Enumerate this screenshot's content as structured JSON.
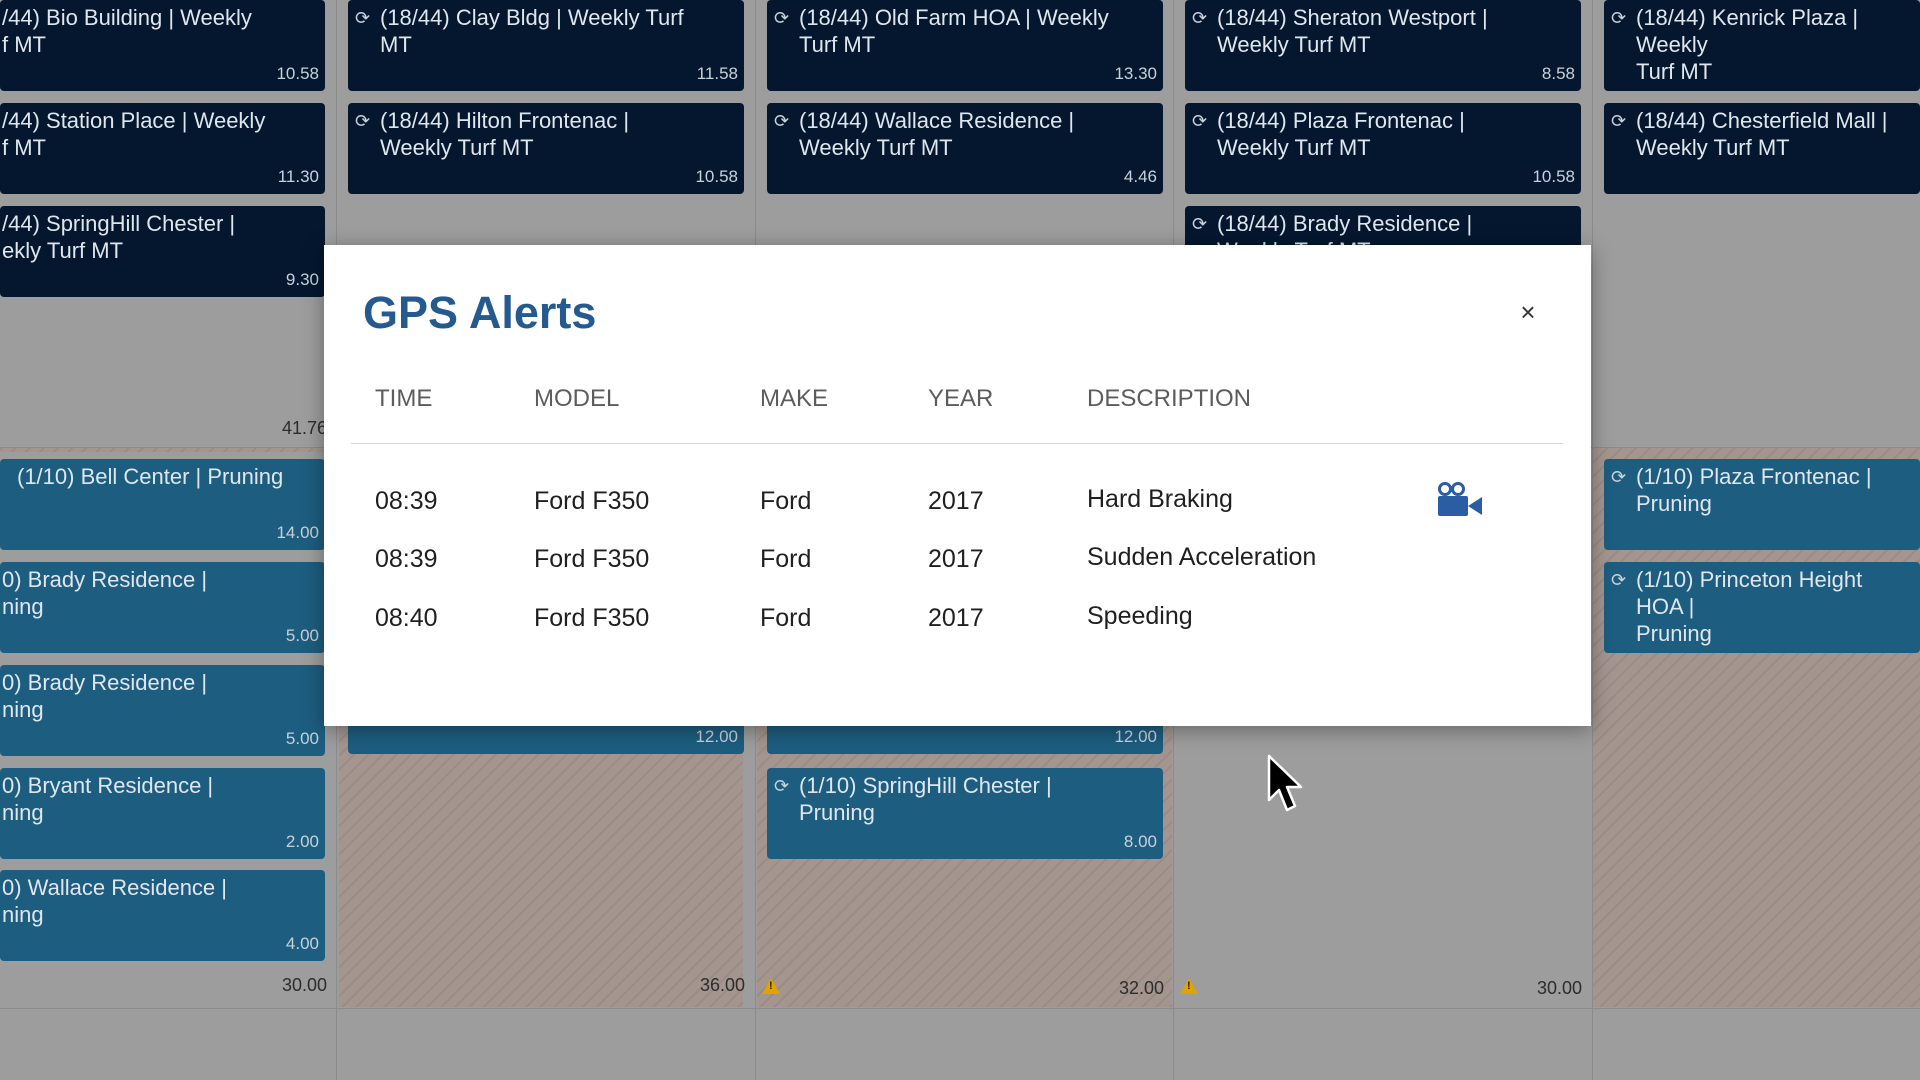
{
  "scheduler": {
    "top_cards": [
      {
        "title": "/44) Bio Building | Weekly\nf MT",
        "hours": "10.58"
      },
      {
        "title": "(18/44) Clay Bldg | Weekly Turf\nMT",
        "hours": "11.58"
      },
      {
        "title": "(18/44) Old Farm HOA | Weekly\nTurf MT",
        "hours": "13.30"
      },
      {
        "title": "(18/44) Sheraton Westport |\nWeekly Turf MT",
        "hours": "8.58"
      },
      {
        "title": "(18/44) Kenrick Plaza | Weekly\nTurf MT",
        "hours": ""
      },
      {
        "title": "/44) Station Place | Weekly\nf MT",
        "hours": "11.30"
      },
      {
        "title": "(18/44) Hilton Frontenac |\nWeekly Turf MT",
        "hours": "10.58"
      },
      {
        "title": "(18/44) Wallace Residence |\nWeekly Turf MT",
        "hours": "4.46"
      },
      {
        "title": "(18/44) Plaza Frontenac |\nWeekly Turf MT",
        "hours": "10.58"
      },
      {
        "title": "(18/44) Chesterfield Mall |\nWeekly Turf MT",
        "hours": ""
      },
      {
        "title": "/44) SpringHill Chester |\nekly Turf MT",
        "hours": "9.30"
      },
      {
        "title": "(18/44) Brady Residence |\nWeekly Turf MT",
        "hours": ""
      }
    ],
    "bottom_cards": [
      {
        "title": "(1/10) Bell Center | Pruning",
        "hours": "14.00"
      },
      {
        "title": "0) Brady Residence |\nning",
        "hours": "5.00"
      },
      {
        "title": "0) Brady Residence |\nning",
        "hours": "5.00"
      },
      {
        "title": "0) Bryant Residence |\nning",
        "hours": "2.00"
      },
      {
        "title": "0) Wallace Residence |\nning",
        "hours": "4.00"
      },
      {
        "title": "",
        "hours": "12.00"
      },
      {
        "title": "",
        "hours": "12.00"
      },
      {
        "title": "(1/10) SpringHill Chester |\nPruning",
        "hours": "8.00"
      },
      {
        "title": "(1/10) Plaza Frontenac | Pruning",
        "hours": ""
      },
      {
        "title": "(1/10) Princeton Height HOA |\nPruning",
        "hours": ""
      }
    ],
    "totals": {
      "top_col1": "41.76",
      "bottom_col1": "30.00",
      "bottom_col2": "36.00",
      "bottom_col3": "32.00",
      "bottom_col4": "30.00"
    }
  },
  "modal": {
    "title": "GPS Alerts",
    "close_label": "×",
    "columns": [
      "TIME",
      "MODEL",
      "MAKE",
      "YEAR",
      "DESCRIPTION"
    ],
    "rows": [
      {
        "time": "08:39",
        "model": "Ford F350",
        "make": "Ford",
        "year": "2017",
        "description": "Hard Braking",
        "has_video": true
      },
      {
        "time": "08:39",
        "model": "Ford F350",
        "make": "Ford",
        "year": "2017",
        "description": "Sudden Acceleration",
        "has_video": false
      },
      {
        "time": "08:40",
        "model": "Ford F350",
        "make": "Ford",
        "year": "2017",
        "description": "Speeding",
        "has_video": false
      }
    ],
    "video_icon": "video-camera-icon"
  },
  "colors": {
    "overlay_bg": "#9d9d9d",
    "card_dark": "#04172f",
    "card_blue": "#1d5d7f",
    "title_blue": "#255a90",
    "warning": "#e0a400"
  }
}
